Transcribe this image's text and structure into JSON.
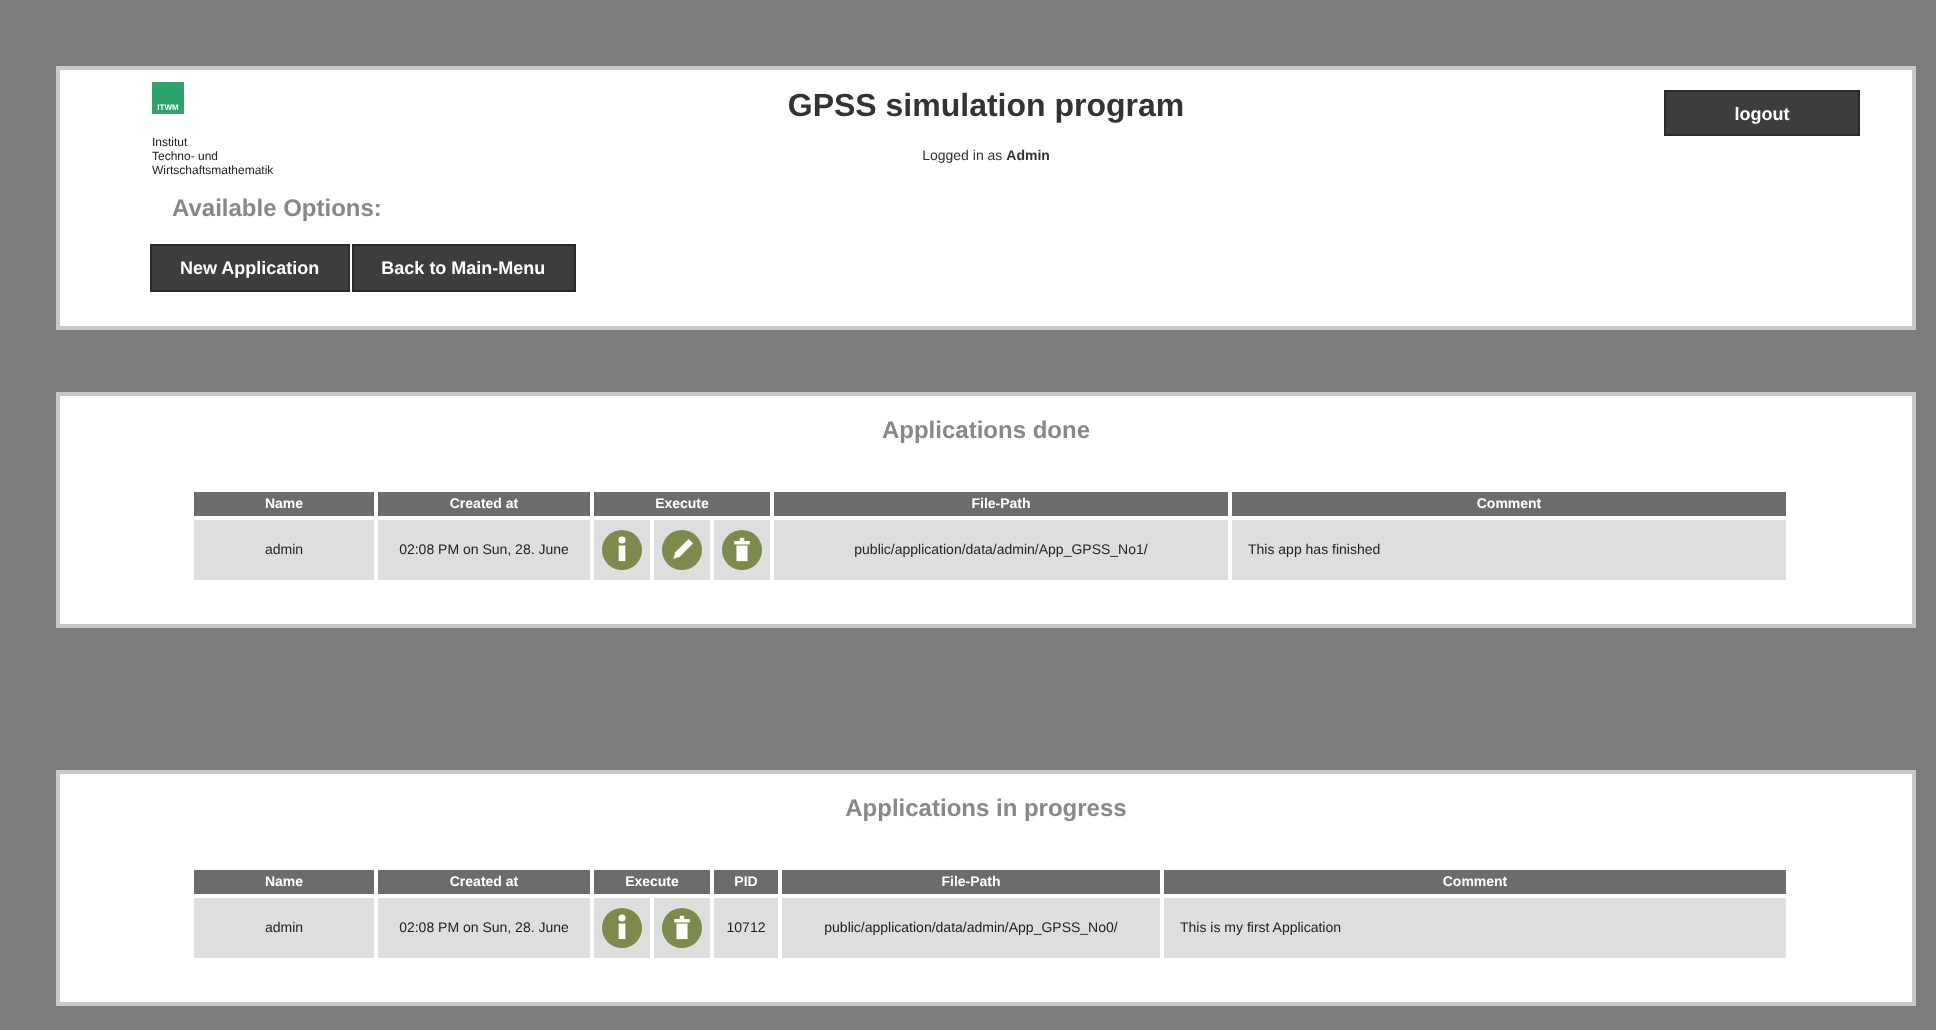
{
  "header": {
    "logo_text": "ITWM",
    "institute_lines": [
      "Institut",
      "Techno- und",
      "Wirtschaftsmathematik"
    ],
    "options_label": "Available Options:",
    "option_buttons": [
      "New Application",
      "Back to Main-Menu"
    ],
    "title": "GPSS simulation program",
    "login_prefix": "Logged in as",
    "user": "Admin",
    "logout": "logout"
  },
  "panels": [
    {
      "title": "Applications done",
      "columns": [
        {
          "label": "Name",
          "kind": "text"
        },
        {
          "label": "Created at",
          "kind": "text"
        },
        {
          "label": "Execute",
          "kind": "actions"
        },
        {
          "label": "File-Path",
          "kind": "text"
        },
        {
          "label": "Comment",
          "kind": "comment"
        }
      ],
      "rows": [
        {
          "cells": [
            "admin",
            "02:08 PM on Sun, 28. June",
            [
              {
                "kind": "info"
              },
              {
                "kind": "edit"
              },
              {
                "kind": "delete"
              }
            ],
            "public/application/data/admin/App_GPSS_No1/",
            "This app has finished"
          ]
        }
      ]
    },
    {
      "title": "Applications in progress",
      "columns": [
        {
          "label": "Name",
          "kind": "text"
        },
        {
          "label": "Created at",
          "kind": "text"
        },
        {
          "label": "Execute",
          "kind": "actions"
        },
        {
          "label": "PID",
          "kind": "text"
        },
        {
          "label": "File-Path",
          "kind": "text"
        },
        {
          "label": "Comment",
          "kind": "comment"
        }
      ],
      "rows": [
        {
          "cells": [
            "admin",
            "02:08 PM on Sun, 28. June",
            [
              {
                "kind": "info"
              },
              {
                "kind": "delete"
              }
            ],
            "10712",
            "public/application/data/admin/App_GPSS_No0/",
            "This is my first Application"
          ]
        }
      ]
    }
  ]
}
